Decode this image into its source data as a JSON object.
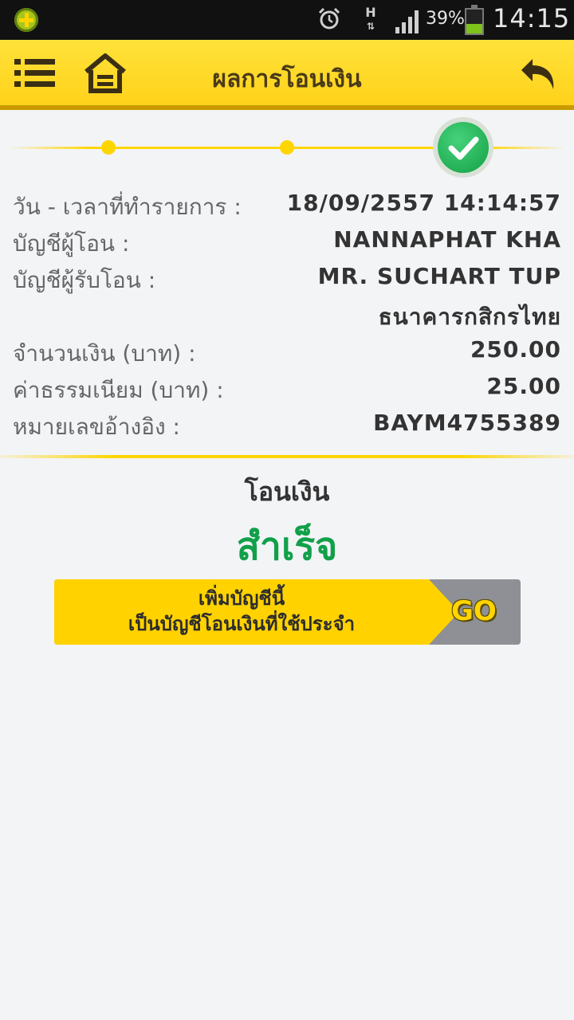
{
  "status_bar": {
    "hspa_label": "H",
    "battery_percent": "39%",
    "battery_level": 0.39,
    "time": "14:15"
  },
  "header": {
    "title": "ผลการโอนเงิน"
  },
  "progress": {
    "steps": 3,
    "current_step": 3
  },
  "details": {
    "datetime_label": "วัน - เวลาที่ทำรายการ :",
    "datetime_value": "18/09/2557 14:14:57",
    "from_label": "บัญชีผู้โอน :",
    "from_value": "NANNAPHAT KHA",
    "to_label": "บัญชีผู้รับโอน :",
    "to_value": "MR. SUCHART TUP",
    "to_bank": "ธนาคารกสิกรไทย",
    "amount_label": "จำนวนเงิน (บาท) :",
    "amount_value": "250.00",
    "fee_label": "ค่าธรรมเนียม (บาท) :",
    "fee_value": "25.00",
    "ref_label": "หมายเลขอ้างอิง :",
    "ref_value": "BAYM4755389"
  },
  "result": {
    "label": "โอนเงิน",
    "status": "สำเร็จ"
  },
  "banner": {
    "line1": "เพิ่มบัญชีนี้",
    "line2": "เป็นบัญชีโอนเงินที่ใช้ประจำ",
    "go_label": "GO"
  },
  "colors": {
    "accent_yellow": "#ffd200",
    "success_green": "#11a04a"
  }
}
